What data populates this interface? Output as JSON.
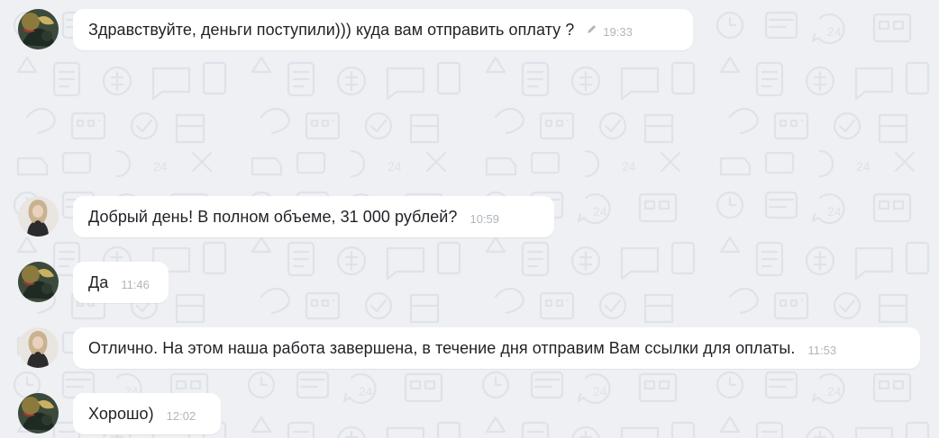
{
  "messages": [
    {
      "sender": "client",
      "text": "Здравствуйте, деньги поступили))) куда вам отправить оплату ?",
      "time": "19:33",
      "edited": true
    },
    {
      "sender": "manager",
      "text": "Добрый день! В полном объеме, 31 000 рублей?",
      "time": "10:59",
      "edited": false
    },
    {
      "sender": "client",
      "text": "Да",
      "time": "11:46",
      "edited": false
    },
    {
      "sender": "manager",
      "text": "Отлично. На этом наша работа завершена, в течение дня отправим Вам ссылки для оплаты.",
      "time": "11:53",
      "edited": false
    },
    {
      "sender": "client",
      "text": "Хорошо)",
      "time": "12:02",
      "edited": false
    }
  ],
  "icons": {
    "edited": "pencil-icon"
  },
  "colors": {
    "background": "#eef0f3",
    "bubble": "#ffffff",
    "text": "#1f2226",
    "time": "#b0b6bd",
    "pattern": "#dfe2e6"
  }
}
